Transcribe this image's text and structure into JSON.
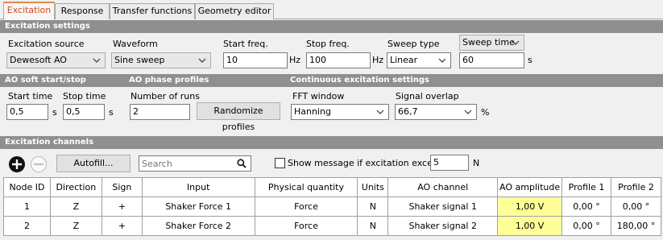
{
  "tabs": [
    {
      "label": "Excitation"
    },
    {
      "label": "Response"
    },
    {
      "label": "Transfer functions"
    },
    {
      "label": "Geometry editor"
    }
  ],
  "excitation_settings": {
    "header": "Excitation settings",
    "source_label": "Excitation source",
    "source_value": "Dewesoft AO",
    "waveform_label": "Waveform",
    "waveform_value": "Sine sweep",
    "start_freq_label": "Start freq.",
    "start_freq_value": "10",
    "start_freq_unit": "Hz",
    "stop_freq_label": "Stop freq.",
    "stop_freq_value": "100",
    "stop_freq_unit": "Hz",
    "sweep_type_label": "Sweep type",
    "sweep_type_value": "Linear",
    "sweep_time_select": "Sweep time",
    "sweep_time_value": "60",
    "sweep_time_unit": "s"
  },
  "soft_start": {
    "header": "AO soft start/stop",
    "start_time_label": "Start time",
    "start_time_value": "0,5",
    "start_time_unit": "s",
    "stop_time_label": "Stop time",
    "stop_time_value": "0,5",
    "stop_time_unit": "s"
  },
  "phase_profiles": {
    "header": "AO phase profiles",
    "runs_label": "Number of runs",
    "runs_value": "2",
    "randomize_label": "Randomize profiles"
  },
  "continuous": {
    "header": "Continuous excitation settings",
    "fft_label": "FFT window",
    "fft_value": "Hanning",
    "overlap_label": "Signal overlap",
    "overlap_value": "66,7",
    "overlap_unit": "%"
  },
  "channels": {
    "header": "Excitation channels",
    "autofill_label": "Autofill...",
    "search_placeholder": "Search",
    "show_message_label": "Show message if excitation exceeds",
    "exceed_value": "5",
    "exceed_unit": "N",
    "columns": [
      "Node ID",
      "Direction",
      "Sign",
      "Input",
      "Physical quantity",
      "Units",
      "AO channel",
      "AO amplitude",
      "Profile 1",
      "Profile 2"
    ],
    "rows": [
      [
        "1",
        "Z",
        "+",
        "Shaker Force 1",
        "Force",
        "N",
        "Shaker signal 1",
        "1,00 V",
        "0,00 °",
        "0,00 °"
      ],
      [
        "2",
        "Z",
        "+",
        "Shaker Force 2",
        "Force",
        "N",
        "Shaker signal 2",
        "1,00 V",
        "0,00 °",
        "180,00 °"
      ]
    ]
  },
  "colors": {
    "active_tab_text": "#d24a1c",
    "section_bg": "#8f8f8f",
    "amplitude_highlight": "#ffff99"
  }
}
